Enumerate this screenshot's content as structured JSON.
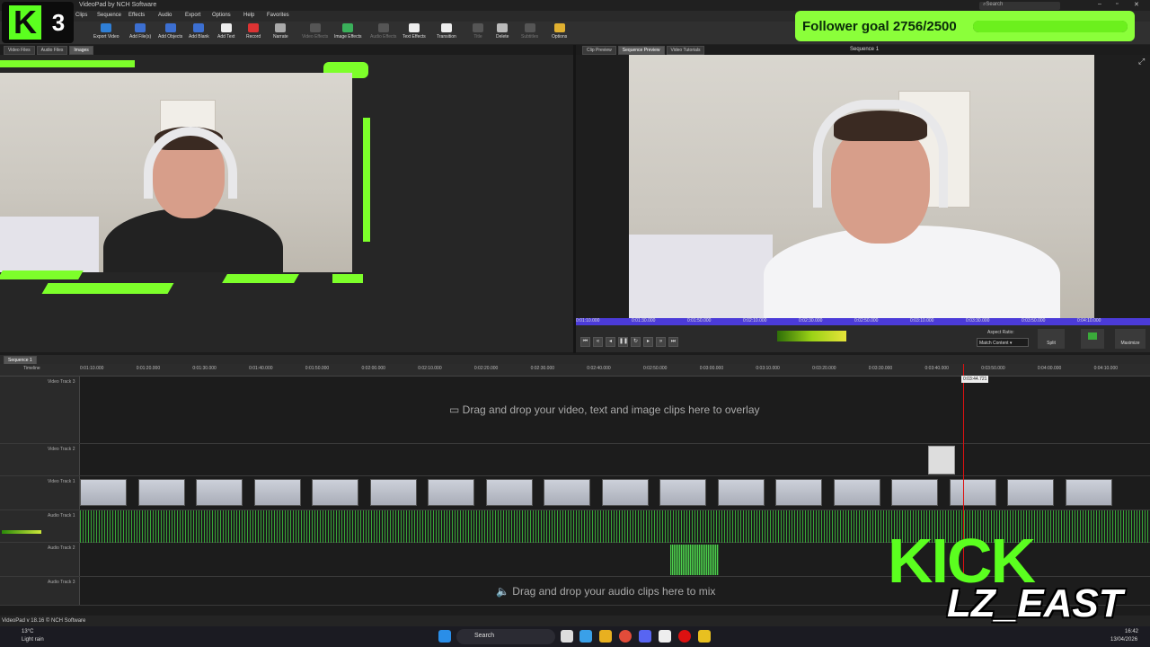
{
  "window": {
    "title": "VideoPad by NCH Software",
    "search_placeholder": "Search"
  },
  "menu": [
    "Clips",
    "Sequence",
    "Effects",
    "Audio",
    "Export",
    "Options",
    "Help",
    "Favorites"
  ],
  "toolbar": [
    {
      "label": "Export Video",
      "color": "#2f7fd6",
      "dim": false
    },
    {
      "label": "Add File(s)",
      "color": "#3c6fd1",
      "dim": false
    },
    {
      "label": "Add Objects",
      "color": "#3c6fd1",
      "dim": false
    },
    {
      "label": "Add Blank",
      "color": "#3c6fd1",
      "dim": false
    },
    {
      "label": "Add Text",
      "color": "#eeeeee",
      "dim": false
    },
    {
      "label": "Record",
      "color": "#d33",
      "dim": false
    },
    {
      "label": "Narrate",
      "color": "#aaa",
      "dim": false
    },
    {
      "label": "Video Effects",
      "color": "#555",
      "dim": true
    },
    {
      "label": "Image Effects",
      "color": "#3ab05a",
      "dim": false
    },
    {
      "label": "Audio Effects",
      "color": "#555",
      "dim": true
    },
    {
      "label": "Text Effects",
      "color": "#eeeeee",
      "dim": false
    },
    {
      "label": "Transition",
      "color": "#eeeeee",
      "dim": false
    },
    {
      "label": "Title",
      "color": "#555",
      "dim": true
    },
    {
      "label": "Delete",
      "color": "#bbb",
      "dim": false
    },
    {
      "label": "Subtitles",
      "color": "#555",
      "dim": true
    },
    {
      "label": "Options",
      "color": "#e0b030",
      "dim": false
    }
  ],
  "left_tabs": [
    "Video Files",
    "Audio Files",
    "Images"
  ],
  "right_tabs": [
    "Clip Preview",
    "Sequence Preview",
    "Video Tutorials"
  ],
  "preview_title": "Sequence 1",
  "goal": {
    "text": "Follower goal 2756/2500",
    "progress": 1.0
  },
  "k3_logo": {
    "letter": "K",
    "number": "3"
  },
  "scrub_times": [
    "0:01:10.000",
    "0:01:30.000",
    "0:01:50.000",
    "0:02:10.000",
    "0:02:30.000",
    "0:02:50.000",
    "0:03:10.000",
    "0:03:30.000",
    "0:03:50.000",
    "0:04:10.000"
  ],
  "aspect": {
    "label": "Aspect Ratio:",
    "value": "Match Content"
  },
  "preview_buttons": {
    "split": "Split",
    "maximize": "Maximize"
  },
  "sequence_tab": "Sequence 1",
  "timeline_label": "Timeline",
  "ruler_ticks": [
    "0:01:10.000",
    "0:01:20.000",
    "0:01:30.000",
    "0:01:40.000",
    "0:01:50.000",
    "0:02:00.000",
    "0:02:10.000",
    "0:02:20.000",
    "0:02:30.000",
    "0:02:40.000",
    "0:02:50.000",
    "0:03:00.000",
    "0:03:10.000",
    "0:03:20.000",
    "0:03:30.000",
    "0:03:40.000",
    "0:03:50.000",
    "0:04:00.000",
    "0:04:10.000"
  ],
  "playhead_time": "0:03:44.721",
  "tracks": {
    "video3": "Video Track 3",
    "video2": "Video Track 2",
    "video1": "Video Track 1",
    "audio1": "Audio Track 1",
    "audio2": "Audio Track 2",
    "audio3": "Audio Track 3"
  },
  "hints": {
    "video": "Drag and drop your video, text and image clips here to overlay",
    "audio": "Drag and drop your audio clips here to mix"
  },
  "statusbar": "VideoPad v 18.16 © NCH Software",
  "taskbar": {
    "weather_temp": "13°C",
    "weather_desc": "Light rain",
    "search": "Search",
    "time": "16:42",
    "date": "13/04/2026"
  },
  "overlay": {
    "kick": "KICK",
    "name": "LZ_EAST"
  },
  "colors": {
    "accent_green": "#7dff2a",
    "scrub": "#4b3bd8",
    "playhead": "#dd1111"
  }
}
